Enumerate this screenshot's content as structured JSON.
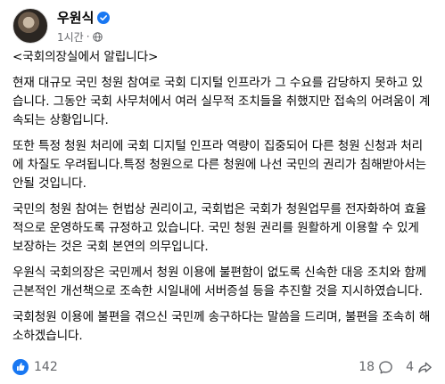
{
  "post": {
    "author": "우원식",
    "time": "1시간",
    "separator": "·",
    "title": "<국회의장실에서 알립니다>",
    "paragraphs": [
      "현재 대규모 국민 청원 참여로 국회 디지털 인프라가 그 수요를 감당하지 못하고 있습니다. 그동안 국회 사무처에서 여러 실무적 조치들을 취했지만 접속의 어려움이 계속되는 상황입니다.",
      "또한 특정 청원 처리에 국회 디지털 인프라 역량이 집중되어 다른 청원 신청과 처리에 차질도 우려됩니다.특정 청원으로 다른 청원에 나선 국민의 권리가 침해받아서는 안될 것입니다.",
      "국민의 청원 참여는 헌법상 권리이고, 국회법은 국회가 청원업무를 전자화하여 효율적으로 운영하도록 규정하고 있습니다. 국민 청원 권리를 원활하게 이용할 수 있게 보장하는 것은 국회 본연의 의무입니다.",
      "우원식 국회의장은 국민께서 청원 이용에 불편함이 없도록 신속한 대응 조치와 함께 근본적인 개선책으로 조속한 시일내에 서버증설 등을 추진할 것을 지시하였습니다.",
      "국회청원 이용에 불편을 겪으신 국민께 송구하다는 말씀을 드리며, 불편을 조속히 해소하겠습니다."
    ]
  },
  "stats": {
    "likes": "142",
    "comments": "18",
    "shares": "4"
  },
  "icons": {
    "verified": "verified-badge-icon",
    "audience": "globe-icon",
    "reaction": "like-icon",
    "comments": "comment-icon",
    "shares": "share-icon"
  },
  "colors": {
    "verified": "#1877f2",
    "meta_text": "#65676b",
    "text": "#050505"
  }
}
